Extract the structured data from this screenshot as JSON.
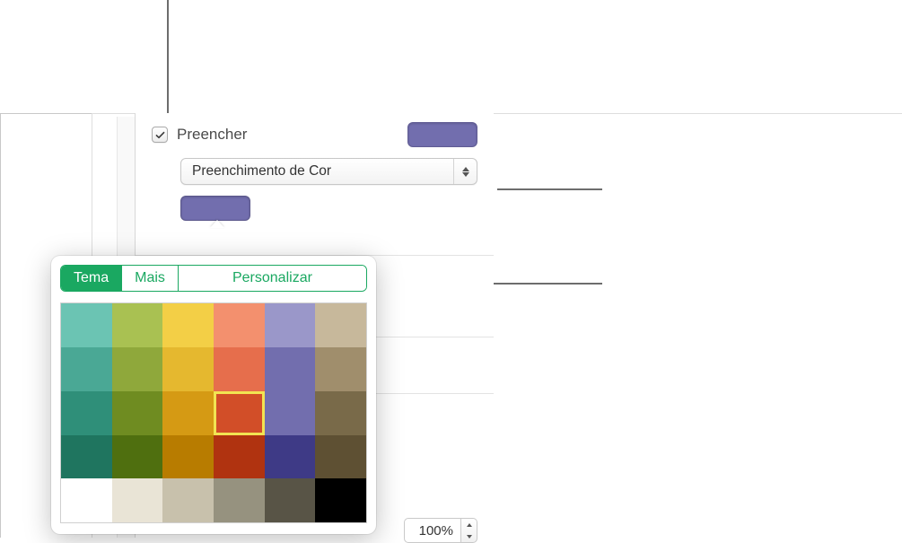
{
  "panel": {
    "fill_checkbox_label": "Preencher",
    "fill_checked": true,
    "fill_color": "#726EAE",
    "fill_type_selected": "Preenchimento de Cor",
    "opacity_value": "100%"
  },
  "popover": {
    "tabs": [
      "Tema",
      "Mais",
      "Personalizar"
    ],
    "active_tab": 0,
    "accent_color": "#1aa861",
    "selected_index": 15,
    "swatches": [
      "#6BC4B3",
      "#A9C152",
      "#F3CF46",
      "#F3906E",
      "#9A97C9",
      "#C7B89B",
      "#4AA895",
      "#8FA83B",
      "#E5B82F",
      "#E66E4C",
      "#726EAE",
      "#A08E6C",
      "#2F8F79",
      "#6F8C21",
      "#D59A14",
      "#D24E28",
      "#726EAE",
      "#796A49",
      "#1F755F",
      "#4F6F0F",
      "#B87C00",
      "#B03310",
      "#3E3A86",
      "#5E5033",
      "#FFFFFF",
      "#E9E4D6",
      "#C8C1AC",
      "#96927F",
      "#585446",
      "#000000"
    ]
  }
}
